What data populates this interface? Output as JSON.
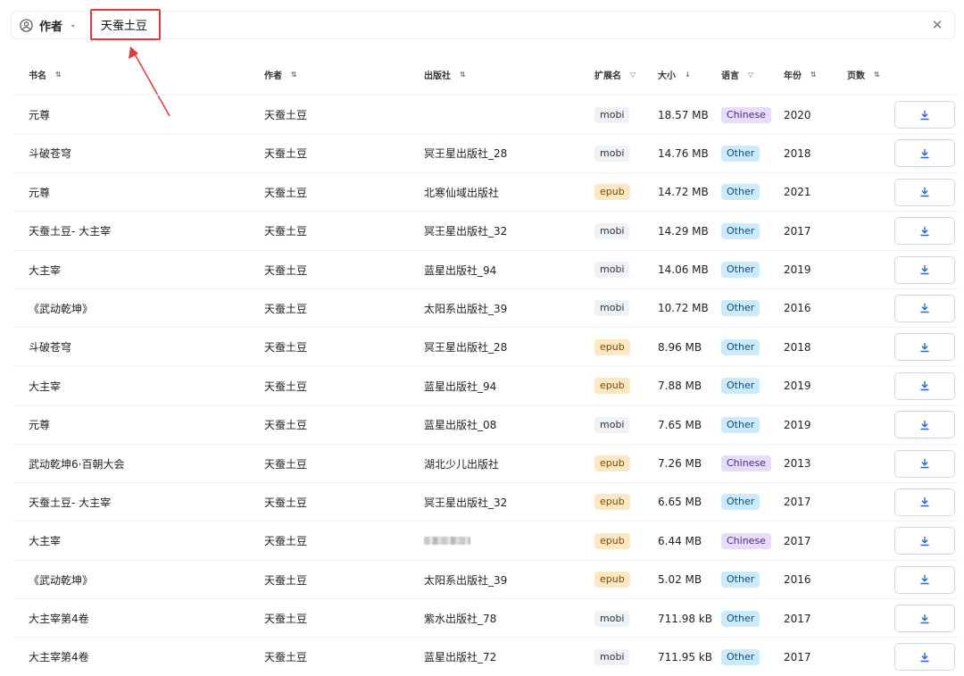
{
  "search": {
    "field_label": "作者",
    "field_icon": "user-circle-icon",
    "query": "天蚕土豆",
    "clear_icon": "close-icon"
  },
  "table": {
    "columns": [
      {
        "label": "书名",
        "sort": "⇅"
      },
      {
        "label": "作者",
        "sort": "⇅"
      },
      {
        "label": "出版社",
        "sort": "⇅"
      },
      {
        "label": "扩展名",
        "sort": "▽"
      },
      {
        "label": "大小",
        "sort": "↓"
      },
      {
        "label": "语言",
        "sort": "▽"
      },
      {
        "label": "年份",
        "sort": "⇅"
      },
      {
        "label": "页数",
        "sort": "⇅"
      }
    ],
    "rows": [
      {
        "title": "元尊",
        "author": "天蚕土豆",
        "publisher": "",
        "ext": "mobi",
        "size": "18.57 MB",
        "lang": "Chinese",
        "year": "2020",
        "pages": ""
      },
      {
        "title": "斗破苍穹",
        "author": "天蚕土豆",
        "publisher": "冥王星出版社_28",
        "ext": "mobi",
        "size": "14.76 MB",
        "lang": "Other",
        "year": "2018",
        "pages": ""
      },
      {
        "title": "元尊",
        "author": "天蚕土豆",
        "publisher": "北寒仙域出版社",
        "ext": "epub",
        "size": "14.72 MB",
        "lang": "Other",
        "year": "2021",
        "pages": ""
      },
      {
        "title": "天蚕土豆- 大主宰",
        "author": "天蚕土豆",
        "publisher": "冥王星出版社_32",
        "ext": "mobi",
        "size": "14.29 MB",
        "lang": "Other",
        "year": "2017",
        "pages": ""
      },
      {
        "title": "大主宰",
        "author": "天蚕土豆",
        "publisher": "蓝星出版社_94",
        "ext": "mobi",
        "size": "14.06 MB",
        "lang": "Other",
        "year": "2019",
        "pages": ""
      },
      {
        "title": "《武动乾坤》",
        "author": "天蚕土豆",
        "publisher": "太阳系出版社_39",
        "ext": "mobi",
        "size": "10.72 MB",
        "lang": "Other",
        "year": "2016",
        "pages": ""
      },
      {
        "title": "斗破苍穹",
        "author": "天蚕土豆",
        "publisher": "冥王星出版社_28",
        "ext": "epub",
        "size": "8.96 MB",
        "lang": "Other",
        "year": "2018",
        "pages": ""
      },
      {
        "title": "大主宰",
        "author": "天蚕土豆",
        "publisher": "蓝星出版社_94",
        "ext": "epub",
        "size": "7.88 MB",
        "lang": "Other",
        "year": "2019",
        "pages": ""
      },
      {
        "title": "元尊",
        "author": "天蚕土豆",
        "publisher": "蓝星出版社_08",
        "ext": "mobi",
        "size": "7.65 MB",
        "lang": "Other",
        "year": "2019",
        "pages": ""
      },
      {
        "title": "武动乾坤6·百朝大会",
        "author": "天蚕土豆",
        "publisher": "湖北少儿出版社",
        "ext": "epub",
        "size": "7.26 MB",
        "lang": "Chinese",
        "year": "2013",
        "pages": ""
      },
      {
        "title": "天蚕土豆- 大主宰",
        "author": "天蚕土豆",
        "publisher": "冥王星出版社_32",
        "ext": "epub",
        "size": "6.65 MB",
        "lang": "Other",
        "year": "2017",
        "pages": ""
      },
      {
        "title": "大主宰",
        "author": "天蚕土豆",
        "publisher": "",
        "ext": "epub",
        "size": "6.44 MB",
        "lang": "Chinese",
        "year": "2017",
        "pages": ""
      },
      {
        "title": "《武动乾坤》",
        "author": "天蚕土豆",
        "publisher": "太阳系出版社_39",
        "ext": "epub",
        "size": "5.02 MB",
        "lang": "Other",
        "year": "2016",
        "pages": ""
      },
      {
        "title": "大主宰第4卷",
        "author": "天蚕土豆",
        "publisher": "紫水出版社_78",
        "ext": "mobi",
        "size": "711.98 kB",
        "lang": "Other",
        "year": "2017",
        "pages": ""
      },
      {
        "title": "大主宰第4卷",
        "author": "天蚕土豆",
        "publisher": "蓝星出版社_72",
        "ext": "mobi",
        "size": "711.95 kB",
        "lang": "Other",
        "year": "2017",
        "pages": ""
      }
    ]
  },
  "colors": {
    "highlight": "#e53935",
    "badge_mobi_bg": "#eef1f5",
    "badge_mobi_fg": "#333333",
    "badge_epub_bg": "#fde8c4",
    "badge_epub_fg": "#7a4a00",
    "badge_chinese_bg": "#e6dcfb",
    "badge_chinese_fg": "#4b2a86",
    "badge_other_bg": "#cdeafc",
    "badge_other_fg": "#0b4d73",
    "download_icon": "#2563eb"
  },
  "icons": {
    "download": "download-icon",
    "sort": "sort-icon"
  }
}
